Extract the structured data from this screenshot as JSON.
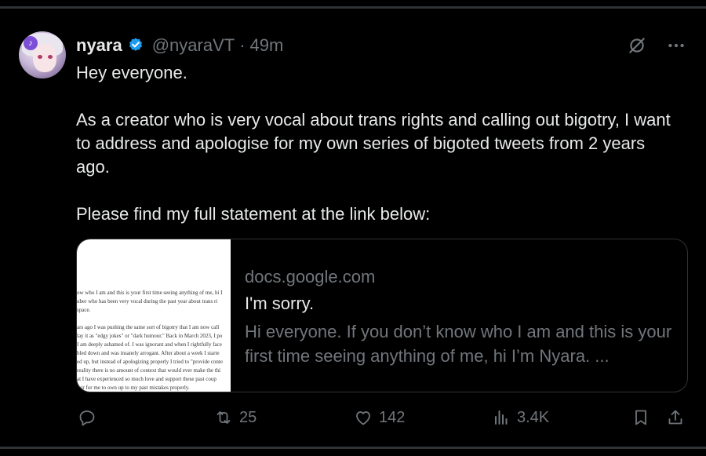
{
  "author": {
    "name": "nyara",
    "handle": "@nyaraVT",
    "separator": "·",
    "time": "49m"
  },
  "tweet": {
    "paragraphs": [
      "Hey everyone.",
      "As a creator who is very vocal about trans rights and calling out bigotry, I want to address and apologise for my own series of bigoted tweets from 2 years ago.",
      "Please find my full statement at the link below:"
    ]
  },
  "card": {
    "domain": "docs.google.com",
    "title": "I'm sorry.",
    "description": "Hi everyone. If you don’t know who I am and this is your first time seeing anything of me, hi I’m Nyara. ...",
    "thumbnail_lines": [
      "ow who I am and this is your first time seeing anything of me, hi I",
      "uber who has been very vocal during the past year about trans ri",
      "space.",
      "",
      "ars ago I was pushing the same sort of bigotry that I am now call",
      "lay it as \"edgy jokes\" or \"dark humour.\" Back in March 2023, I po",
      "I am deeply ashamed of. I was ignorant and when I rightfully face",
      "bled down and was insanely arrogant. After about a week I starte",
      "ed up, but instead of apologizing properly I tried to \"provide conte",
      "reality there is no amount of context that would ever make the thi",
      "",
      "",
      "at I have experienced so much love and support these past coup",
      "fair for me to own up to my past mistakes properly."
    ]
  },
  "stats": {
    "replies": "",
    "reposts": "25",
    "likes": "142",
    "views": "3.4K"
  },
  "colors": {
    "background": "#000000",
    "text": "#e7e9ea",
    "muted": "#71767b",
    "verified": "#1d9bf0",
    "border": "#2f3336"
  }
}
